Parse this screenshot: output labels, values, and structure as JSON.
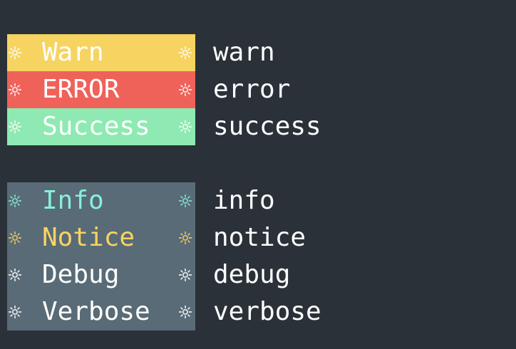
{
  "colors": {
    "background": "#2a3138",
    "text": "#ffffff",
    "warn_bg": "#f7d461",
    "error_bg": "#ef625a",
    "success_bg": "#8eeab2",
    "muted_bg": "#596b76",
    "info_accent": "#87f0dc",
    "notice_accent": "#f7d461"
  },
  "icons": {
    "sun": "sun-icon"
  },
  "log_levels": [
    {
      "key": "warn",
      "label": "Warn",
      "tag": "warn",
      "bg": "#f7d461",
      "label_color": "#ffffff",
      "icon_color": "#ffffff"
    },
    {
      "key": "error",
      "label": "ERROR",
      "tag": "error",
      "bg": "#ef625a",
      "label_color": "#ffffff",
      "icon_color": "#ffffff"
    },
    {
      "key": "success",
      "label": "Success",
      "tag": "success",
      "bg": "#8eeab2",
      "label_color": "#ffffff",
      "icon_color": "#ffffff"
    },
    {
      "key": "info",
      "label": "Info",
      "tag": "info",
      "bg": "#596b76",
      "label_color": "#87f0dc",
      "icon_color": "#87f0dc"
    },
    {
      "key": "notice",
      "label": "Notice",
      "tag": "notice",
      "bg": "#596b76",
      "label_color": "#f7d461",
      "icon_color": "#f7d461"
    },
    {
      "key": "debug",
      "label": "Debug",
      "tag": "debug",
      "bg": "#596b76",
      "label_color": "#ffffff",
      "icon_color": "#ffffff"
    },
    {
      "key": "verbose",
      "label": "Verbose",
      "tag": "verbose",
      "bg": "#596b76",
      "label_color": "#ffffff",
      "icon_color": "#ffffff"
    }
  ]
}
